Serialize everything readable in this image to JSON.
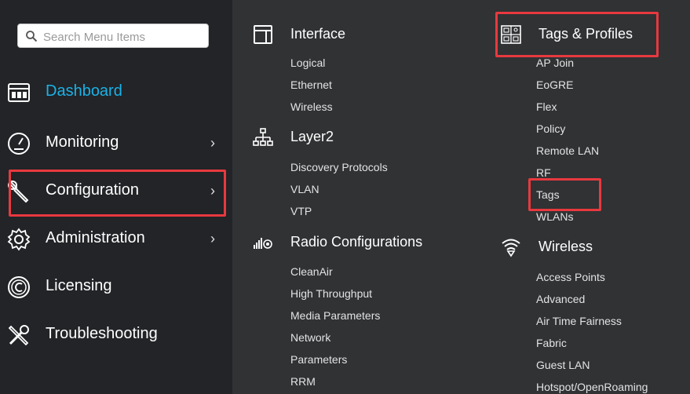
{
  "search": {
    "placeholder": "Search Menu Items",
    "icon": "search-icon"
  },
  "sidebar": {
    "items": [
      {
        "label": "Dashboard",
        "icon": "dashboard-icon",
        "active": true
      },
      {
        "label": "Monitoring",
        "icon": "gauge-icon",
        "chevron": "›"
      },
      {
        "label": "Configuration",
        "icon": "wrench-icon",
        "chevron": "›",
        "highlighted": true
      },
      {
        "label": "Administration",
        "icon": "gear-icon",
        "chevron": "›"
      },
      {
        "label": "Licensing",
        "icon": "copyright-icon"
      },
      {
        "label": "Troubleshooting",
        "icon": "tools-icon"
      }
    ]
  },
  "menu": {
    "interface": {
      "label": "Interface",
      "items": [
        "Logical",
        "Ethernet",
        "Wireless"
      ]
    },
    "layer2": {
      "label": "Layer2",
      "items": [
        "Discovery Protocols",
        "VLAN",
        "VTP"
      ]
    },
    "radio": {
      "label": "Radio Configurations",
      "items": [
        "CleanAir",
        "High Throughput",
        "Media Parameters",
        "Network",
        "Parameters",
        "RRM"
      ]
    },
    "tags_profiles": {
      "label": "Tags & Profiles",
      "items": [
        "AP Join",
        "EoGRE",
        "Flex",
        "Policy",
        "Remote LAN",
        "RF",
        "Tags",
        "WLANs"
      ]
    },
    "wireless": {
      "label": "Wireless",
      "items": [
        "Access Points",
        "Advanced",
        "Air Time Fairness",
        "Fabric",
        "Guest LAN",
        "Hotspot/OpenRoaming"
      ]
    }
  },
  "colors": {
    "accent": "#1ab2e8",
    "highlight": "#e8393f",
    "sidebar_bg": "#222427",
    "menu_bg": "#303234"
  }
}
